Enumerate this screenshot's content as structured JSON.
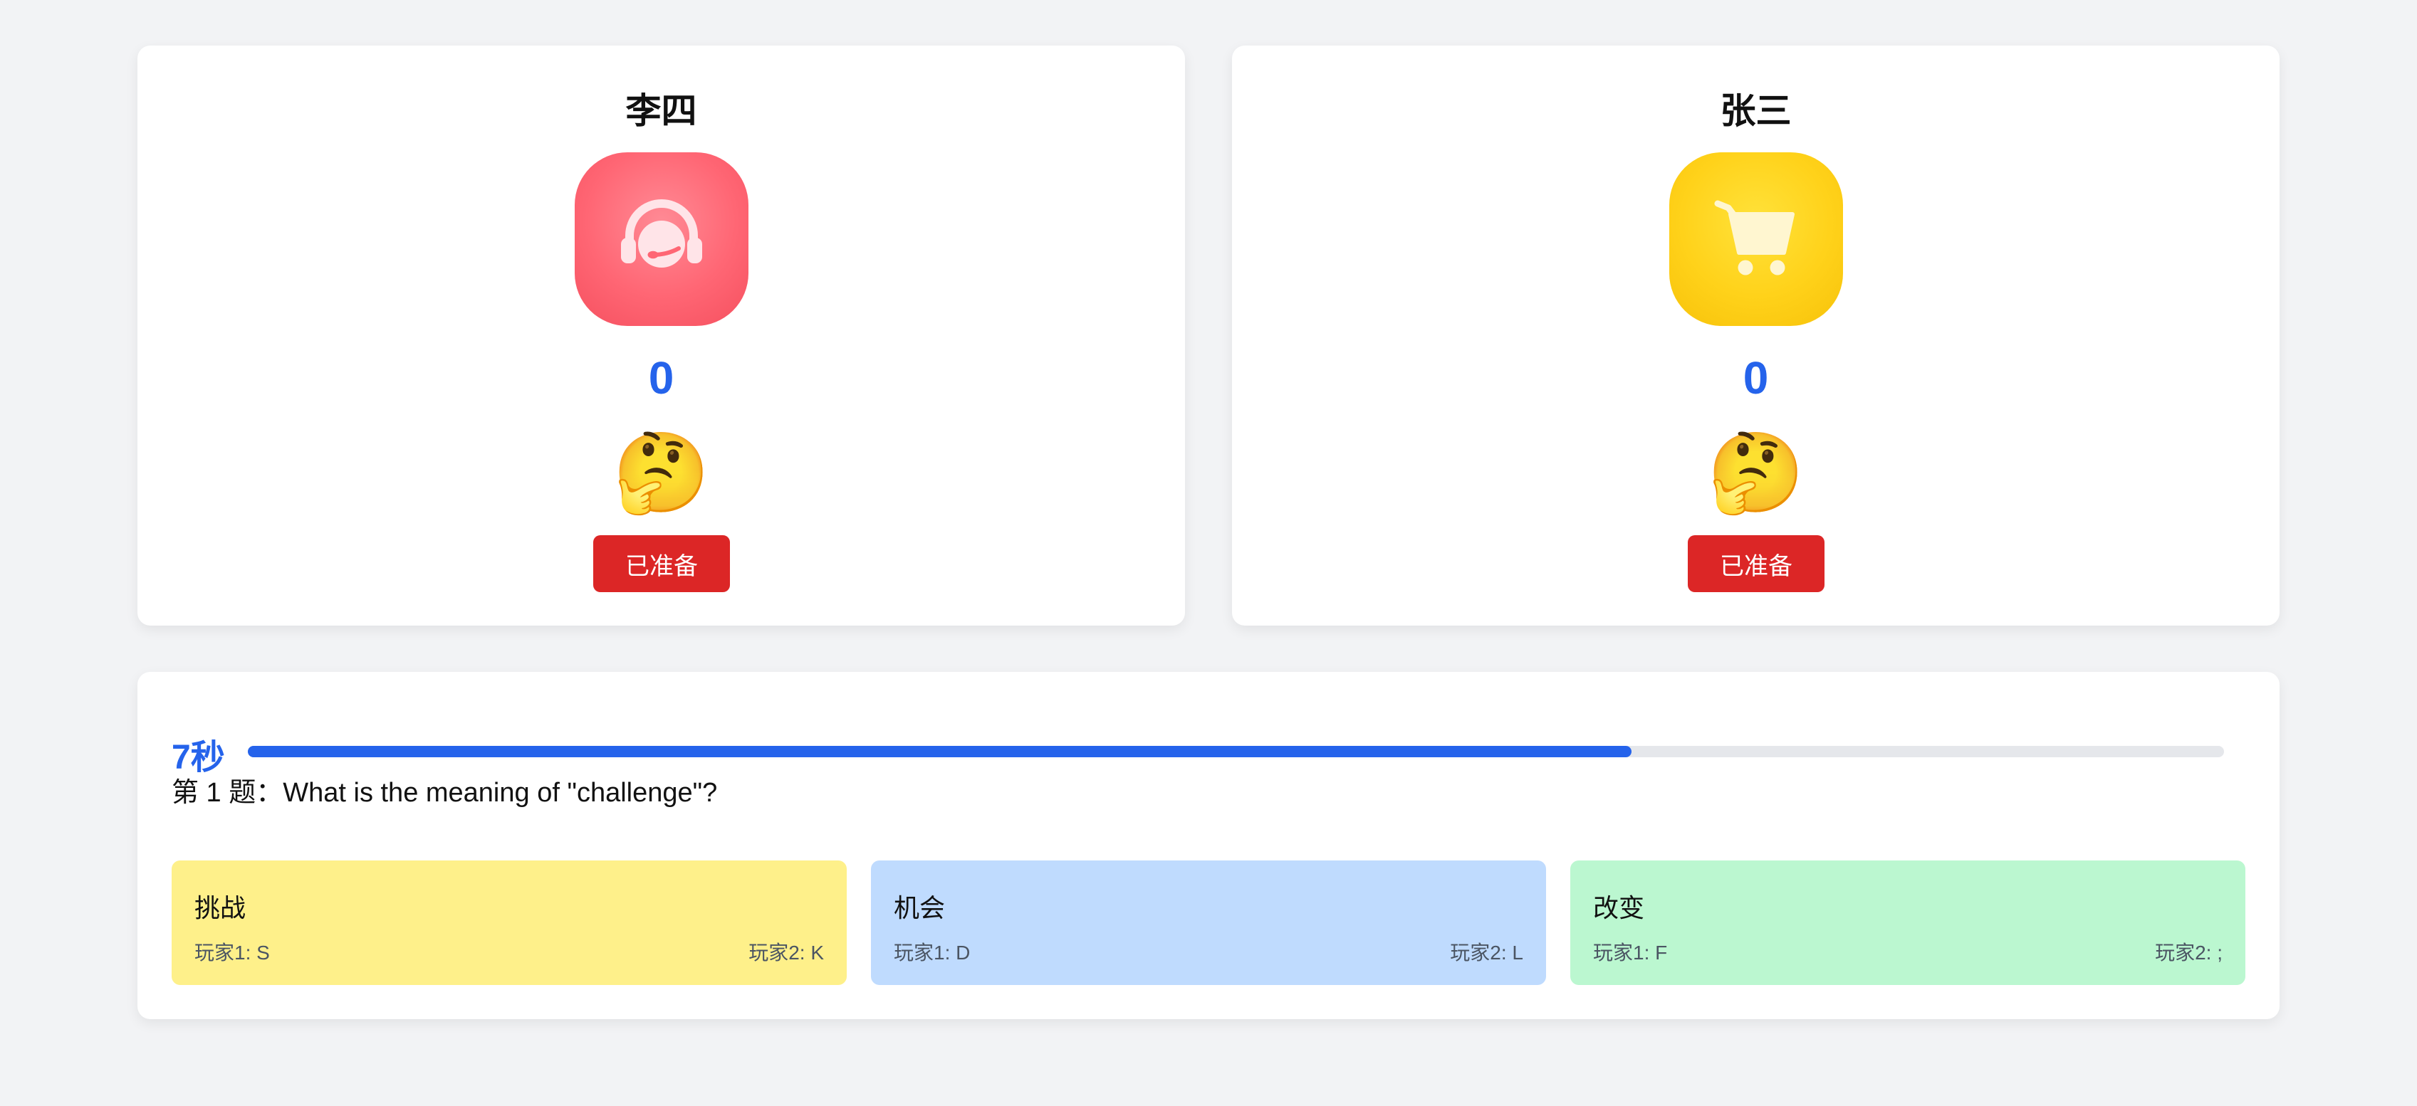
{
  "players": [
    {
      "name": "李四",
      "avatar_icon": "headset-icon",
      "avatar_color": "#ff6674",
      "score": "0",
      "emoji": "🤔",
      "status_button": "已准备"
    },
    {
      "name": "张三",
      "avatar_icon": "shopping-cart-icon",
      "avatar_color": "#ffd21a",
      "score": "0",
      "emoji": "🤔",
      "status_button": "已准备"
    }
  ],
  "timer": {
    "label": "7秒",
    "progress_fraction": 0.7
  },
  "question": {
    "text": "第 1 题：What is the meaning of \"challenge\"?"
  },
  "options": [
    {
      "text": "挑战",
      "player1_key": "玩家1: S",
      "player2_key": "玩家2: K",
      "color": "#fef08a"
    },
    {
      "text": "机会",
      "player1_key": "玩家1: D",
      "player2_key": "玩家2: L",
      "color": "#bfdbfe"
    },
    {
      "text": "改变",
      "player1_key": "玩家1: F",
      "player2_key": "玩家2: ;",
      "color": "#bbf7d0"
    }
  ],
  "colors": {
    "accent": "#2563eb",
    "ready_button": "#dc2626",
    "page_background": "#f2f3f5"
  }
}
